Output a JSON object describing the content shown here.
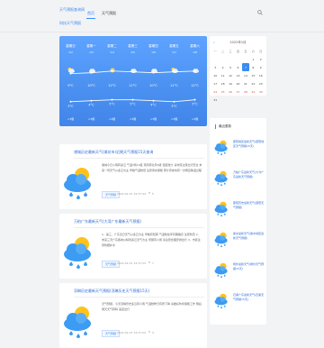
{
  "header": {
    "brand_line1": "天气预报查询网",
    "brand_line2": "科技天气预报",
    "nav": [
      "首页",
      "天气预报"
    ],
    "search_icon": "search-icon"
  },
  "forecast": {
    "days": [
      {
        "week": "星期日",
        "date": "1/2",
        "icon": "partly-cloudy-icon",
        "high": "9°C",
        "low": "3°C",
        "wind": "<3级"
      },
      {
        "week": "星期一",
        "date": "1/3",
        "icon": "rain-icon",
        "high": "10°C",
        "low": "4°C",
        "wind": "<3级"
      },
      {
        "week": "星期二",
        "date": "1/4",
        "icon": "sun-icon",
        "high": "12°C",
        "low": "5°C",
        "wind": "<3级"
      },
      {
        "week": "星期三",
        "date": "1/5",
        "icon": "cloudy-icon",
        "high": "11°C",
        "low": "5°C",
        "wind": "<3级"
      },
      {
        "week": "星期四",
        "date": "1/6",
        "icon": "cloudy-icon",
        "high": "10°C",
        "low": "4°C",
        "wind": "<3级"
      },
      {
        "week": "星期五",
        "date": "1/7",
        "icon": "partly-cloudy-icon",
        "high": "11°C",
        "low": "3°C",
        "wind": "<3级"
      },
      {
        "week": "星期六",
        "date": "1/8",
        "icon": "cloudy-icon",
        "high": "12°C",
        "low": "5°C",
        "wind": "<3级"
      }
    ]
  },
  "articles": [
    {
      "title": "诸城历史最新天气(潍坊市)近期天气预报15天查询",
      "summary": "诸城今日小雨转多云 气温3到10度 南风转北风3级 湿度较大 请市民注意出行安全 未来一周天气以多云为主 早晚气温较低 注意添衣保暖 预计周末将有一次明显降温过程",
      "tag": "天气预报",
      "date": "2022-01-07 14:37:44",
      "views": "5"
    },
    {
      "title": "万柏广东最新天气(大湾广东最新天气预报)",
      "summary": "1、第三、广东近日天气以多云为主 早晚有轻雾 气温较往年同期偏高 注意防范 2、未来三天广东各地以晴到多云天气为主 局部有小雨 请注意合理安排出行 3、市民注意防晒补水",
      "tag": "天气预报",
      "date": "2022-01-07 14:37:34",
      "views": "7"
    },
    {
      "title": "羽琳历史最新天气预报(羽琳历史天气预报15天)",
      "summary": "天气预报、今天羽琳历史多云转小雨 气温较昨日有所下降 请做好防寒保暖工作 明后两天天气转晴 适宜出行",
      "tag": "天气预报",
      "date": "2022-01-07 14:37:24",
      "views": "4"
    }
  ],
  "calendar": {
    "caption": "2022年1月",
    "prev": "«",
    "weekdays": [
      "一",
      "二",
      "三",
      "四",
      "五",
      "六",
      "日"
    ],
    "weeks": [
      [
        "",
        "",
        "",
        "",
        "",
        "1",
        "2"
      ],
      [
        "3",
        "4",
        "5",
        "6",
        "7",
        "8",
        "9"
      ],
      [
        "10",
        "11",
        "12",
        "13",
        "14",
        "15",
        "16"
      ],
      [
        "17",
        "18",
        "19",
        "20",
        "21",
        "22",
        "23"
      ],
      [
        "24",
        "25",
        "26",
        "27",
        "28",
        "29",
        "30"
      ],
      [
        "31",
        "",
        "",
        "",
        "",
        "",
        ""
      ]
    ],
    "today": "7"
  },
  "recent": {
    "heading": "最近更新",
    "items": [
      "邵阳地区最新天气(邵阳地区天气预报15天)",
      "万柏广东最新天气(大湾广东最新天气预报)",
      "邵阳历史最新天气(邵阳天气预报)",
      "衡水最新天气(衡水地区最新天气预报)",
      "杨外最新天气(杨外天气预报15天)",
      "石梁广东最新天气(石梁天气预报15天)"
    ]
  },
  "colors": {
    "accent": "#3b8bf2",
    "forecast_bg": "#4a90f0"
  }
}
